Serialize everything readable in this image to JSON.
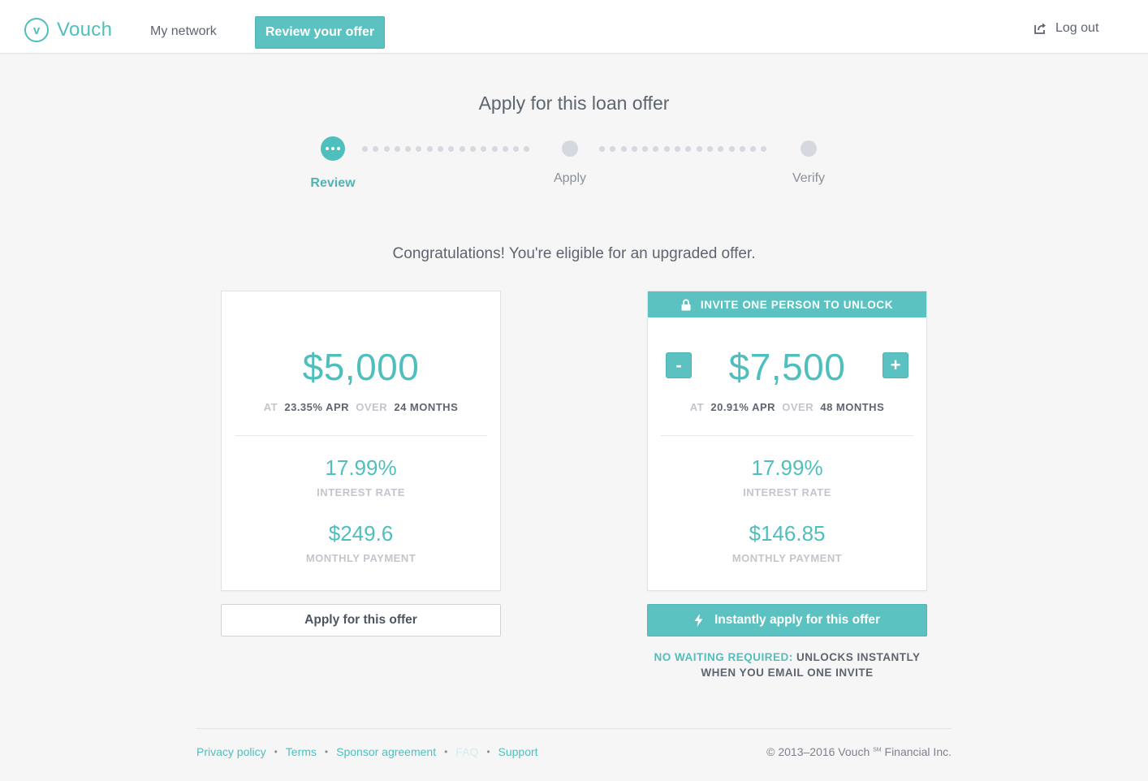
{
  "header": {
    "brand": "Vouch",
    "logo_letter": "v",
    "nav_network": "My network",
    "nav_review": "Review your offer",
    "logout": "Log out"
  },
  "page": {
    "title": "Apply for this loan offer",
    "steps": [
      {
        "label": "Review",
        "state": "active"
      },
      {
        "label": "Apply",
        "state": "pending"
      },
      {
        "label": "Verify",
        "state": "pending"
      }
    ],
    "congrats": "Congratulations! You're eligible for an upgraded offer."
  },
  "offer_basic": {
    "amount": "$5,000",
    "at_label": "AT",
    "apr": "23.35% APR",
    "over_label": "OVER",
    "term": "24 MONTHS",
    "interest_rate": "17.99%",
    "interest_rate_label": "INTEREST RATE",
    "monthly_payment": "$249.6",
    "monthly_payment_label": "MONTHLY PAYMENT",
    "button": "Apply for this offer"
  },
  "offer_upgraded": {
    "banner": "INVITE ONE PERSON TO UNLOCK",
    "amount": "$7,500",
    "decrement": "-",
    "increment": "+",
    "at_label": "AT",
    "apr": "20.91% APR",
    "over_label": "OVER",
    "term": "48 MONTHS",
    "interest_rate": "17.99%",
    "interest_rate_label": "INTEREST RATE",
    "monthly_payment": "$146.85",
    "monthly_payment_label": "MONTHLY PAYMENT",
    "button": "Instantly apply for this offer",
    "note_highlight": "NO WAITING REQUIRED:",
    "note_line1": "UNLOCKS INSTANTLY",
    "note_line2": "WHEN YOU EMAIL ONE INVITE"
  },
  "footer": {
    "links": [
      "Privacy policy",
      "Terms",
      "Sponsor agreement",
      "FAQ",
      "Support"
    ],
    "separator": "•",
    "copyright_prefix": "© 2013–2016 Vouch",
    "copyright_mark": "SM",
    "copyright_suffix": "Financial Inc."
  },
  "colors": {
    "accent": "#4fbfbd",
    "button_teal": "#5cc1c1",
    "background": "#f6f6f6",
    "text": "#5e6470",
    "muted": "#c2c6cc"
  },
  "icons": {
    "logo": "vouch-logo-icon",
    "logout": "logout-icon",
    "lock": "lock-icon",
    "lightning": "lightning-icon",
    "progress": "ellipsis-icon"
  }
}
